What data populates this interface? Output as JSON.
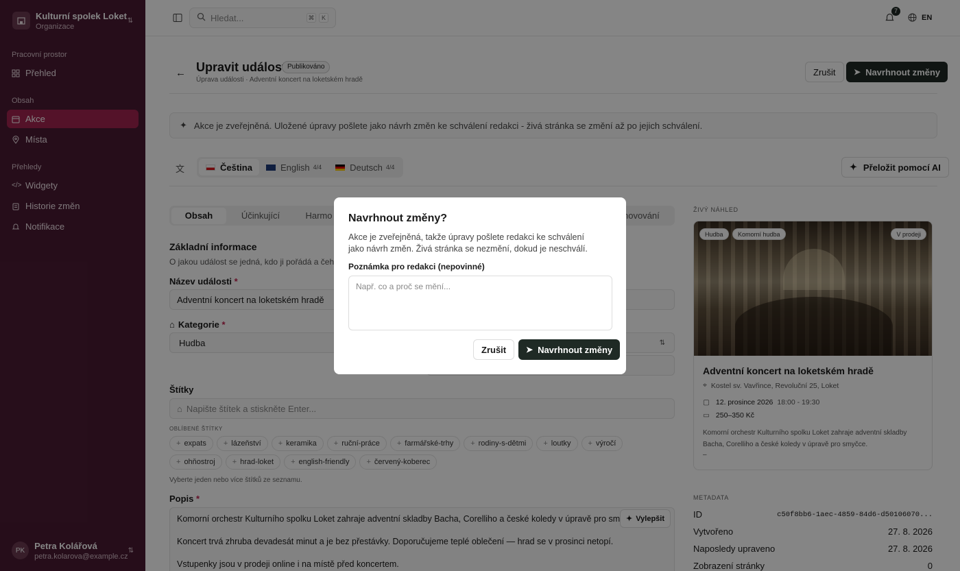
{
  "org": {
    "name": "Kulturní spolek Loket",
    "type": "Organizace"
  },
  "sidebar": {
    "sections": [
      {
        "title": "Pracovní prostor",
        "items": [
          {
            "label": "Přehled",
            "icon": "grid-icon"
          }
        ]
      },
      {
        "title": "Obsah",
        "items": [
          {
            "label": "Akce",
            "icon": "calendar-icon",
            "active": true
          },
          {
            "label": "Místa",
            "icon": "pin-icon"
          }
        ]
      },
      {
        "title": "Přehledy",
        "items": [
          {
            "label": "Widgety",
            "icon": "code-icon"
          },
          {
            "label": "Historie změn",
            "icon": "clipboard-icon"
          },
          {
            "label": "Notifikace",
            "icon": "bell-icon"
          }
        ]
      }
    ]
  },
  "user": {
    "initials": "PK",
    "name": "Petra Kolářová",
    "email": "petra.kolarova@example.cz"
  },
  "topbar": {
    "search_placeholder": "Hledat...",
    "kbd1": "⌘",
    "kbd2": "K",
    "notifications": "7",
    "lang": "EN"
  },
  "page": {
    "title": "Upravit událost",
    "status": "Publikováno",
    "subtitle": "Úprava události · Adventní koncert na loketském hradě",
    "cancel": "Zrušit",
    "propose": "Navrhnout změny",
    "notice": "Akce je zveřejněná. Uložené úpravy pošlete jako návrh změn ke schválení redakci - živá stránka se změní až po jejich schválení.",
    "languages": [
      {
        "label": "Čeština",
        "flag": "cz",
        "count": ""
      },
      {
        "label": "English",
        "flag": "gb",
        "count": "4/4"
      },
      {
        "label": "Deutsch",
        "flag": "de",
        "count": "4/4"
      }
    ],
    "translate_ai": "Přeložit pomocí AI"
  },
  "form": {
    "tabs": [
      "Obsah",
      "Účinkující",
      "Harmo",
      "novování"
    ],
    "section_title": "Základní informace",
    "section_desc": "O jakou událost se jedná, kdo ji pořádá a čeho",
    "name_label": "Název události",
    "name_value": "Adventní koncert na loketském hradě",
    "category_label": "Kategorie",
    "category_value": "Hudba",
    "tags_label": "Štítky",
    "tags_placeholder": "Napište štítek a stiskněte Enter...",
    "popular_label": "OBLÍBENÉ ŠTÍTKY",
    "popular_tags": [
      "expats",
      "lázeňství",
      "keramika",
      "ruční-práce",
      "farmářské-trhy",
      "rodiny-s-dětmi",
      "loutky",
      "výročí",
      "ohňostroj",
      "hrad-loket",
      "english-friendly",
      "červený-koberec"
    ],
    "tags_hint": "Vyberte jeden nebo více štítků ze seznamu.",
    "desc_label": "Popis",
    "improve": "Vylepšit",
    "desc_lines": [
      "Komorní orchestr Kulturního spolku Loket zahraje adventní skladby Bacha, Corelliho a české koledy v úpravě pro smyčce.",
      "Koncert trvá zhruba devadesát minut a je bez přestávky. Doporučujeme teplé oblečení — hrad se v prosinci netopí.",
      "Vstupenky jsou v prodeji online i na místě před koncertem."
    ],
    "required": "*"
  },
  "preview": {
    "label": "ŽIVÝ NÁHLED",
    "badges": [
      "Hudba",
      "Komorní hudba"
    ],
    "sale_badge": "V prodeji",
    "title": "Adventní koncert na loketském hradě",
    "place": "Kostel sv. Vavřince, Revoluční 25, Loket",
    "date": "12. prosince 2026",
    "time": "18:00 - 19:30",
    "price": "250–350 Kč",
    "desc": "Komorní orchestr Kulturního spolku Loket zahraje adventní skladby Bacha, Corelliho a české koledy v úpravě pro smyčce.",
    "ellipsis": "–"
  },
  "metadata": {
    "label": "METADATA",
    "rows": [
      {
        "k": "ID",
        "v": "c50f8bb6-1aec-4859-84d6-d50106070..."
      },
      {
        "k": "Vytvořeno",
        "v": "27. 8. 2026"
      },
      {
        "k": "Naposledy upraveno",
        "v": "27. 8. 2026"
      },
      {
        "k": "Zobrazení stránky",
        "v": "0"
      }
    ]
  },
  "modal": {
    "title": "Navrhnout změny?",
    "desc": "Akce je zveřejněná, takže úpravy pošlete redakci ke schválení jako návrh změn. Živá stránka se nezmění, dokud je neschválí.",
    "note_label": "Poznámka pro redakci (nepovinné)",
    "note_placeholder": "Např. co a proč se mění...",
    "cancel": "Zrušit",
    "submit": "Navrhnout změny"
  }
}
